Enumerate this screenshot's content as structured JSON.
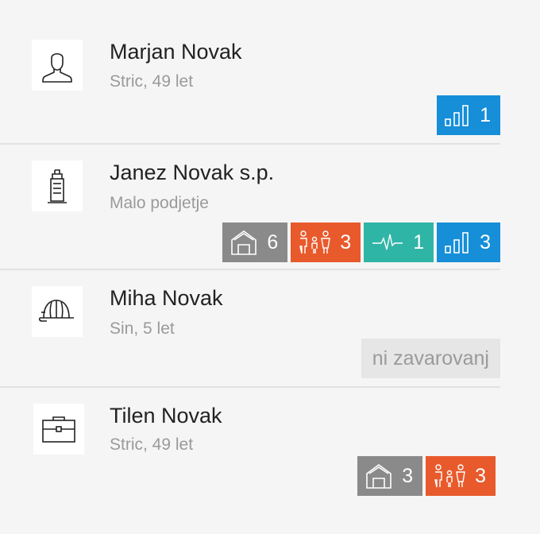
{
  "people": [
    {
      "name": "Marjan Novak",
      "subtitle": "Stric, 49 let",
      "icon": "person-icon",
      "badges": [
        {
          "type": "signal",
          "icon": "signal-bars-icon",
          "count": "1",
          "color": "#168ed8"
        }
      ]
    },
    {
      "name": "Janez Novak s.p.",
      "subtitle": "Malo podjetje",
      "icon": "building-icon",
      "badges": [
        {
          "type": "house",
          "icon": "house-icon",
          "count": "6",
          "color": "#8a8a8a"
        },
        {
          "type": "family",
          "icon": "family-icon",
          "count": "3",
          "color": "#e85a2c"
        },
        {
          "type": "health",
          "icon": "heartbeat-icon",
          "count": "1",
          "color": "#2fb5a6"
        },
        {
          "type": "signal",
          "icon": "signal-bars-icon",
          "count": "3",
          "color": "#168ed8"
        }
      ]
    },
    {
      "name": "Miha Novak",
      "subtitle": "Sin, 5 let",
      "icon": "cap-icon",
      "empty_label": "ni zavarovanj"
    },
    {
      "name": "Tilen Novak",
      "subtitle": "Stric, 49 let",
      "icon": "briefcase-icon",
      "badges": [
        {
          "type": "house",
          "icon": "house-icon",
          "count": "3",
          "color": "#8a8a8a"
        },
        {
          "type": "family",
          "icon": "family-icon",
          "count": "3",
          "color": "#e85a2c"
        }
      ]
    }
  ]
}
